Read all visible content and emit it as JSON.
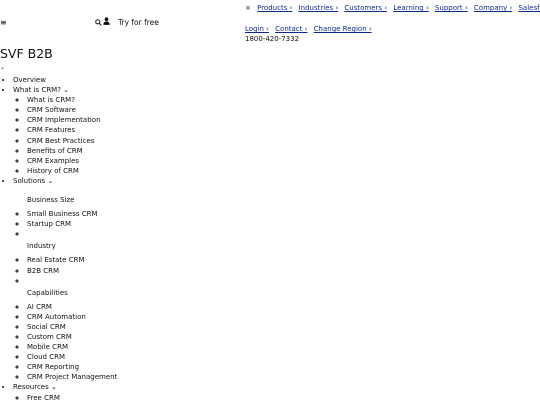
{
  "header": {
    "menu_icon": "hamburger-icon",
    "search_icon": "search-icon",
    "user_icon": "user-icon",
    "try_label": "Try for free"
  },
  "top_nav": {
    "close_label": "×",
    "items": [
      "Products ›",
      "Industries ›",
      "Customers ›",
      "Learning ›",
      "Support ›",
      "Company ›",
      "Salesforce+ ›"
    ]
  },
  "utility_nav": {
    "items": [
      "Login ›",
      "Contact ›",
      "Change Region ›"
    ],
    "phone": "1800-420-7332"
  },
  "brand": {
    "title": "SVF B2B",
    "caret": "⌄"
  },
  "menu": {
    "overview": "Overview",
    "what_is_crm": {
      "label": "What is CRM? ⌄",
      "items": [
        "What is CRM?",
        "CRM Software",
        "CRM Implementation",
        "CRM Features",
        "CRM Best Practices",
        "Benefits of CRM",
        "CRM Examples",
        "History of CRM"
      ]
    },
    "solutions": {
      "label": "Solutions ⌄",
      "business_size": {
        "heading": "Business Size",
        "items": [
          "Small Business CRM",
          "Startup CRM"
        ]
      },
      "industry": {
        "heading": "Industry",
        "items": [
          "Real Estate CRM",
          "B2B CRM"
        ]
      },
      "capabilities": {
        "heading": "Capabilities",
        "items": [
          "AI CRM",
          "CRM Automation",
          "Social CRM",
          "Custom CRM",
          "Mobile CRM",
          "Cloud CRM",
          "CRM Reporting",
          "CRM Project Management"
        ]
      }
    },
    "resources": {
      "label": "Resources ⌄",
      "items": [
        "Free CRM"
      ]
    }
  }
}
